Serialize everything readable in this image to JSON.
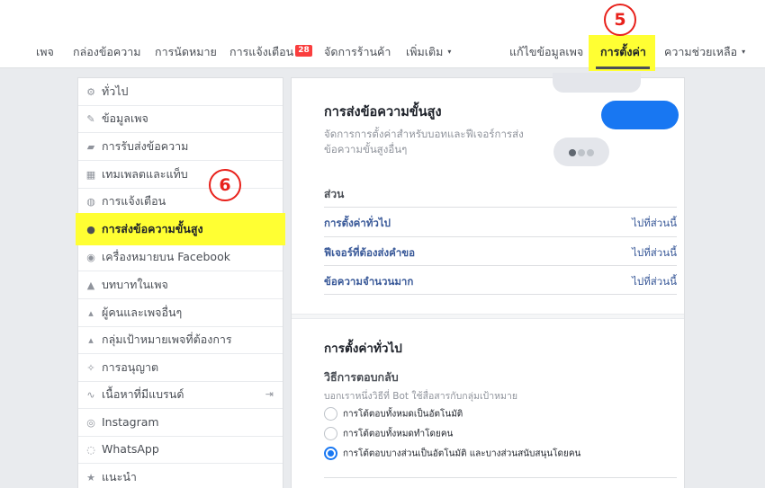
{
  "nav": {
    "items": [
      "เพจ",
      "กล่องข้อความ",
      "การนัดหมาย",
      "การแจ้งเตือน",
      "จัดการร้านค้า",
      "เพิ่มเติม"
    ],
    "notifications_badge": "28",
    "more_caret": "▾",
    "edit_page_info": "แก้ไขข้อมูลเพจ",
    "settings": "การตั้งค่า",
    "help": "ความช่วยเหลือ",
    "help_caret": "▾"
  },
  "steps": {
    "step5": "5",
    "step6": "6"
  },
  "sidebar": {
    "items": [
      {
        "label": "ทั่วไป",
        "icon": "gear-icon",
        "glyph": "⚙"
      },
      {
        "label": "ข้อมูลเพจ",
        "icon": "pencil-icon",
        "glyph": "✎"
      },
      {
        "label": "การรับส่งข้อความ",
        "icon": "chat-icon",
        "glyph": "▰"
      },
      {
        "label": "เทมเพลตและแท็บ",
        "icon": "grid-icon",
        "glyph": "▦"
      },
      {
        "label": "การแจ้งเตือน",
        "icon": "globe-icon",
        "glyph": "◍"
      },
      {
        "label": "การส่งข้อความขั้นสูง",
        "icon": "messenger-icon",
        "glyph": "●"
      },
      {
        "label": "เครื่องหมายบน Facebook",
        "icon": "badge-icon",
        "glyph": "◉"
      },
      {
        "label": "บทบาทในเพจ",
        "icon": "person-icon",
        "glyph": "▲"
      },
      {
        "label": "ผู้คนและเพจอื่นๆ",
        "icon": "people-icon",
        "glyph": "▴"
      },
      {
        "label": "กลุ่มเป้าหมายเพจที่ต้องการ",
        "icon": "people-icon",
        "glyph": "▴"
      },
      {
        "label": "การอนุญาต",
        "icon": "wrench-icon",
        "glyph": "✧"
      },
      {
        "label": "เนื้อหาที่มีแบรนด์",
        "icon": "handshake-icon",
        "glyph": "∿"
      },
      {
        "label": "Instagram",
        "icon": "instagram-icon",
        "glyph": "◎"
      },
      {
        "label": "WhatsApp",
        "icon": "whatsapp-icon",
        "glyph": "◌"
      },
      {
        "label": "แนะนำ",
        "icon": "star-icon",
        "glyph": "★"
      }
    ],
    "branded_trail": "⇥"
  },
  "main": {
    "title": "การส่งข้อความขั้นสูง",
    "description": "จัดการการตั้งค่าสำหรับบอทและฟีเจอร์การส่งข้อความขั้นสูงอื่นๆ",
    "toc_header": "ส่วน",
    "toc": [
      {
        "label": "การตั้งค่าทั่วไป",
        "go": "ไปที่ส่วนนี้"
      },
      {
        "label": "ฟีเจอร์ที่ต้องส่งคำขอ",
        "go": "ไปที่ส่วนนี้"
      },
      {
        "label": "ข้อความจำนวนมาก",
        "go": "ไปที่ส่วนนี้"
      }
    ],
    "general_title": "การตั้งค่าทั่วไป",
    "reply_title": "วิธีการตอบกลับ",
    "reply_desc": "บอกเราหนึ่งวิธีที่ Bot ใช้สื่อสารกับกลุ่มเป้าหมาย",
    "options": [
      "การโต้ตอบทั้งหมดเป็นอัตโนมัติ",
      "การโต้ตอบทั้งหมดทำโดยคน",
      "การโต้ตอบบางส่วนเป็นอัตโนมัติ และบางส่วนสนับสนุนโดยคน"
    ],
    "selected_option": 2
  },
  "colors": {
    "highlight": "#ffff33",
    "step_circle": "#e8211b",
    "primary_blue": "#1877f2",
    "link": "#385898"
  }
}
